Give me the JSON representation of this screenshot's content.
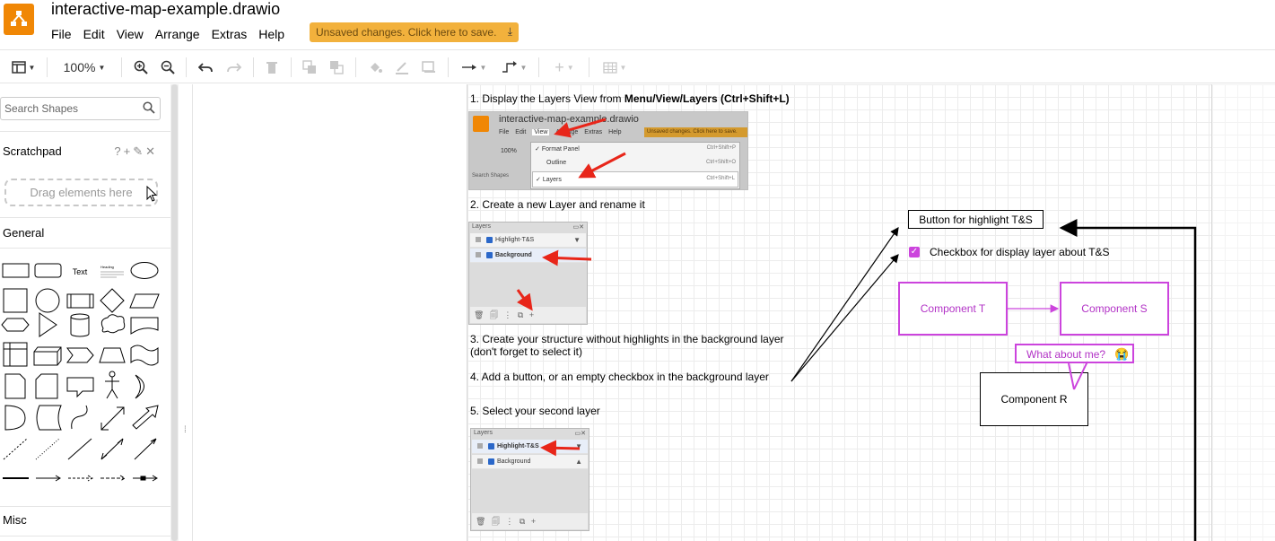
{
  "window": {
    "title": "interactive-map-example.drawio",
    "unsaved_label": "Unsaved changes. Click here to save."
  },
  "menu": [
    "File",
    "Edit",
    "View",
    "Arrange",
    "Extras",
    "Help"
  ],
  "toolbar": {
    "zoom": "100%",
    "icons": [
      "panel-layout-icon",
      "zoom-in-icon",
      "zoom-out-icon",
      "undo-icon",
      "redo-icon",
      "delete-icon",
      "to-front-icon",
      "to-back-icon",
      "fill-color-icon",
      "line-color-icon",
      "shadow-icon",
      "connection-icon",
      "waypoints-icon",
      "insert-icon",
      "table-icon"
    ]
  },
  "sidebar": {
    "search_placeholder": "Search Shapes",
    "scratchpad_label": "Scratchpad",
    "scratchpad_icons": "?+✎✕",
    "drag_hint": "Drag elements here",
    "general_label": "General",
    "misc_label": "Misc",
    "shape_text_label": "Text",
    "shape_heading_label": "Heading"
  },
  "canvas": {
    "steps": {
      "s1_prefix": "1. Display the Layers View from ",
      "s1_bold": "Menu/View/Layers (Ctrl+Shift+L)",
      "s2": "2. Create a new Layer and rename it",
      "s3_line1": "3. Create your structure without highlights in the background layer",
      "s3_line2": "(don't forget to select it)",
      "s4": "4. Add a button, or an empty checkbox in the background layer",
      "s5": "5. Select your second layer"
    },
    "shot1": {
      "title": "interactive-map-example.drawio",
      "menu": [
        "File",
        "Edit",
        "View",
        "Arrange",
        "Extras",
        "Help"
      ],
      "unsaved": "Unsaved changes. Click here to save.",
      "zoom": "100%",
      "search": "Search Shapes",
      "items": [
        {
          "label": "Format Panel",
          "shortcut": "Ctrl+Shift+P"
        },
        {
          "label": "Outline",
          "shortcut": "Ctrl+Shift+O"
        },
        {
          "label": "Layers",
          "shortcut": "Ctrl+Shift+L"
        }
      ]
    },
    "layers_panel_1": {
      "title": "Layers",
      "rows": [
        "Highlight-T&S",
        "Background"
      ],
      "footer": "🗑 🗐 ⋮ ⧉ +"
    },
    "layers_panel_2": {
      "title": "Layers",
      "rows": [
        "Highlight-T&S",
        "Background"
      ],
      "footer": "🗑 🗐 ⋮ ⧉ +"
    },
    "diagram": {
      "button_label": "Button for highlight T&S",
      "checkbox_label": "Checkbox for display layer about T&S",
      "component_t": "Component T",
      "component_s": "Component S",
      "component_r": "Component R",
      "callout": "What about me?",
      "callout_emoji": "😭",
      "accent_color": "#cc44dd"
    }
  }
}
